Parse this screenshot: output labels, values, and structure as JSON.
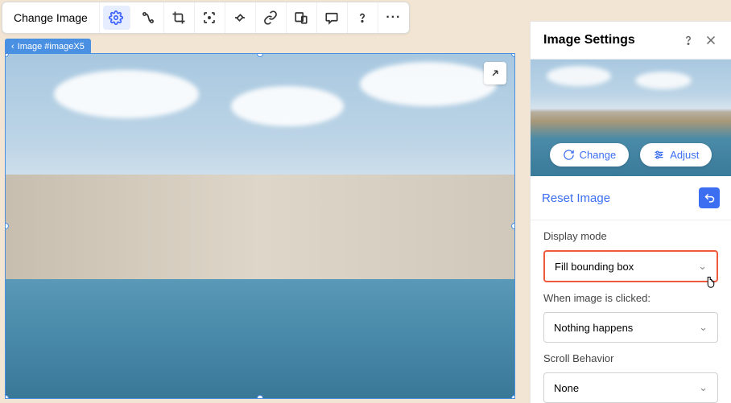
{
  "toolbar": {
    "change_image_label": "Change Image",
    "icons": {
      "settings": "settings-icon",
      "path": "path-icon",
      "crop": "crop-icon",
      "focus": "focus-icon",
      "flip": "flip-icon",
      "link": "link-icon",
      "responsive": "responsive-icon",
      "comment": "comment-icon",
      "help": "help-icon",
      "more": "more-icon"
    }
  },
  "breadcrumb": {
    "label": "Image #imageX5"
  },
  "panel": {
    "title": "Image Settings",
    "change_label": "Change",
    "adjust_label": "Adjust",
    "reset_label": "Reset Image",
    "sections": {
      "display_mode": {
        "label": "Display mode",
        "value": "Fill bounding box"
      },
      "on_click": {
        "label": "When image is clicked:",
        "value": "Nothing happens"
      },
      "scroll": {
        "label": "Scroll Behavior",
        "value": "None"
      }
    }
  }
}
